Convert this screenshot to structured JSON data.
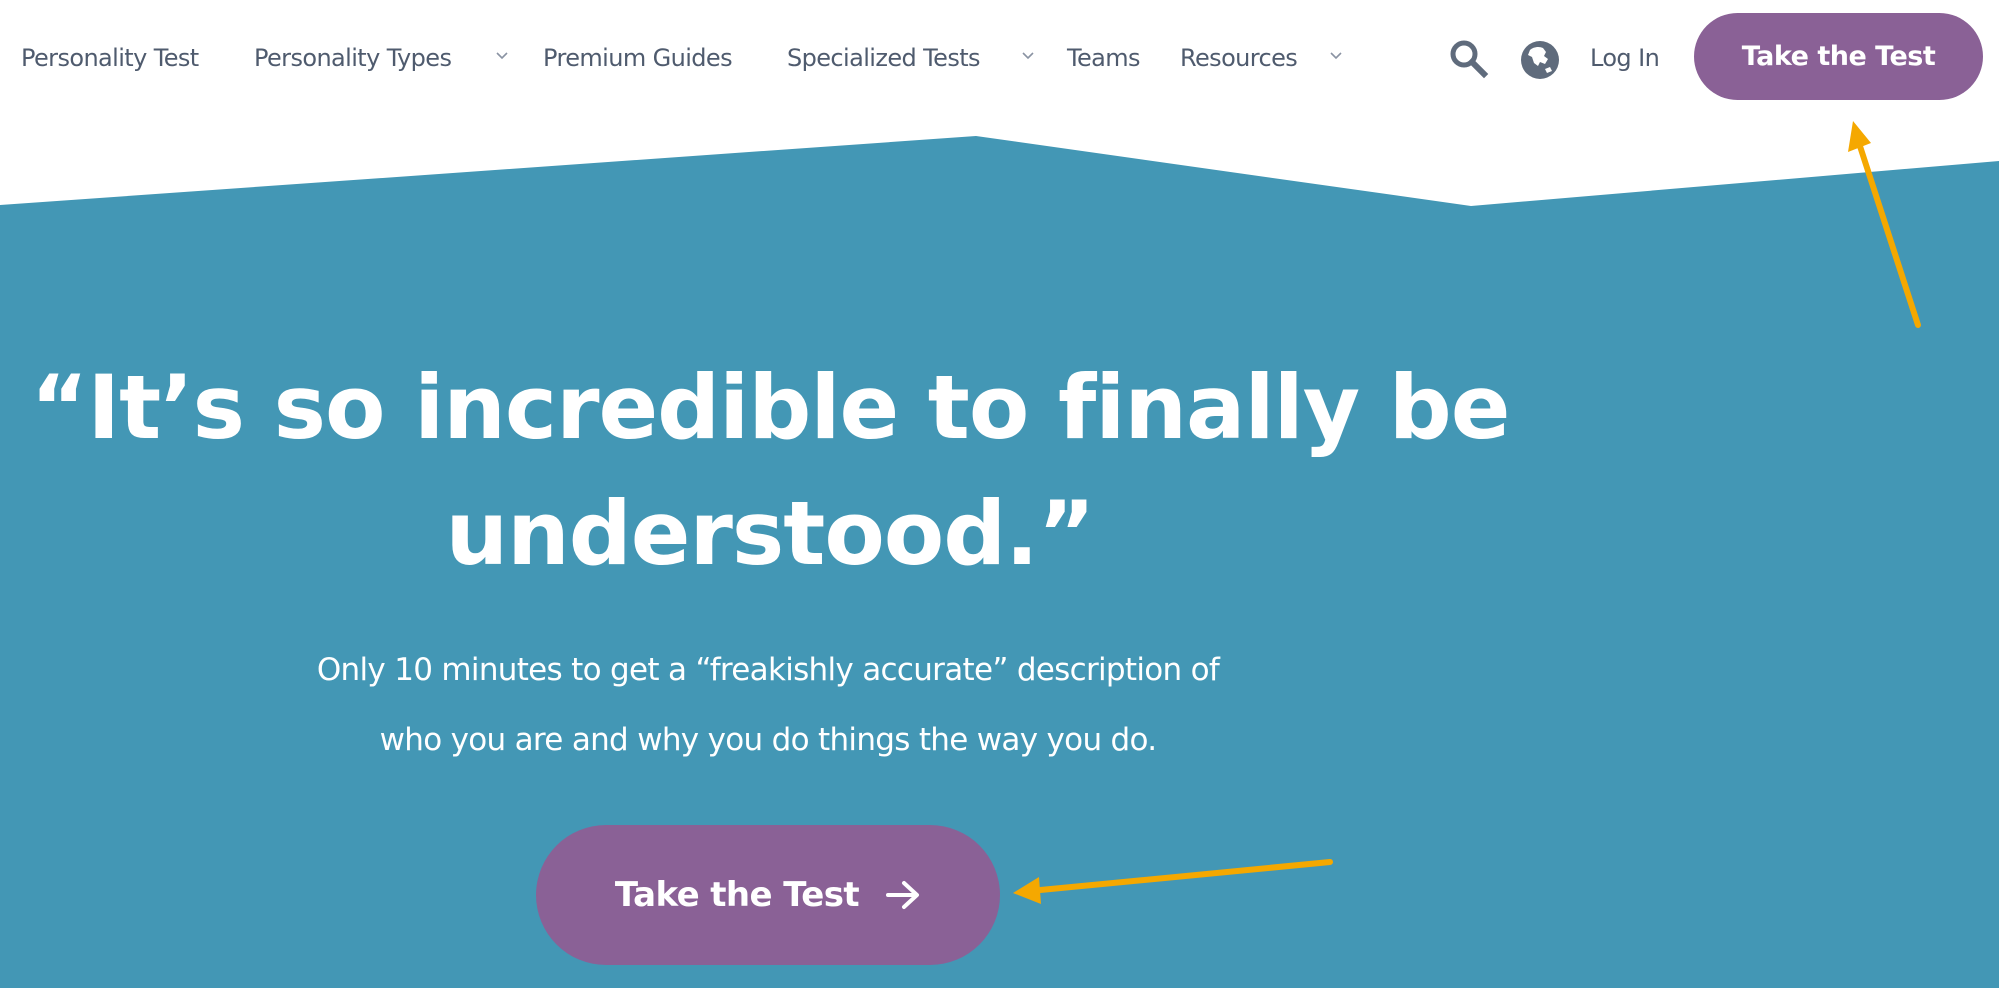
{
  "colors": {
    "hero_background": "#4397b5",
    "brand_purple": "#8a6196",
    "nav_text": "#4f5b6e",
    "icon_gray": "#5f6b7c",
    "annotation_arrow": "#f5a800",
    "page_background": "#ffffff"
  },
  "header": {
    "nav": [
      {
        "label": "Personality Test",
        "has_dropdown": false
      },
      {
        "label": "Personality Types",
        "has_dropdown": true
      },
      {
        "label": "Premium Guides",
        "has_dropdown": false
      },
      {
        "label": "Specialized Tests",
        "has_dropdown": true
      },
      {
        "label": "Teams",
        "has_dropdown": false
      },
      {
        "label": "Resources",
        "has_dropdown": true
      }
    ],
    "icons": {
      "search": "search-icon",
      "language": "globe-icon",
      "dropdown": "chevron-down-icon"
    },
    "login_label": "Log In",
    "cta_label": "Take the Test"
  },
  "hero": {
    "headline_line1": "“It’s so incredible to finally be",
    "headline_line2": "understood.”",
    "subtext_line1": "Only 10 minutes to get a “freakishly accurate” description of",
    "subtext_line2": "who you are and why you do things the way you do.",
    "cta_label": "Take the Test",
    "cta_icon": "arrow-right-icon"
  },
  "annotations": [
    {
      "type": "arrow",
      "points_to": "header-take-test-button"
    },
    {
      "type": "arrow",
      "points_to": "hero-take-test-button"
    }
  ]
}
